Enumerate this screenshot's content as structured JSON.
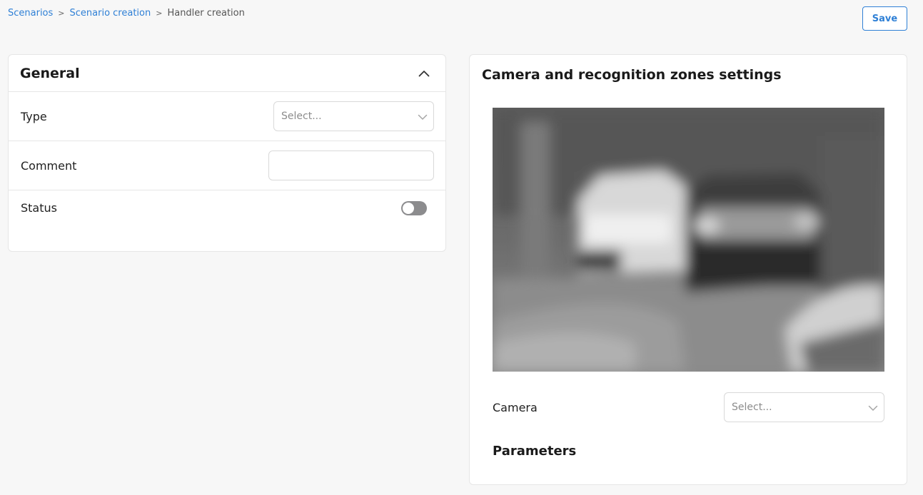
{
  "breadcrumb": {
    "items": [
      "Scenarios",
      "Scenario creation"
    ],
    "current": "Handler creation",
    "separator": ">"
  },
  "toolbar": {
    "save_label": "Save"
  },
  "general": {
    "title": "General",
    "type": {
      "label": "Type",
      "placeholder": "Select..."
    },
    "comment": {
      "label": "Comment",
      "value": ""
    },
    "status": {
      "label": "Status",
      "enabled": false
    }
  },
  "camera_settings": {
    "title": "Camera and recognition zones settings",
    "camera": {
      "label": "Camera",
      "placeholder": "Select..."
    },
    "parameters_title": "Parameters"
  },
  "colors": {
    "accent": "#2f80d6",
    "background": "#f7f7f7",
    "card": "#ffffff",
    "toggle_off": "#8c8c8e"
  },
  "icons": {
    "collapse": "chevron-up-icon",
    "select": "chevron-down-icon"
  }
}
